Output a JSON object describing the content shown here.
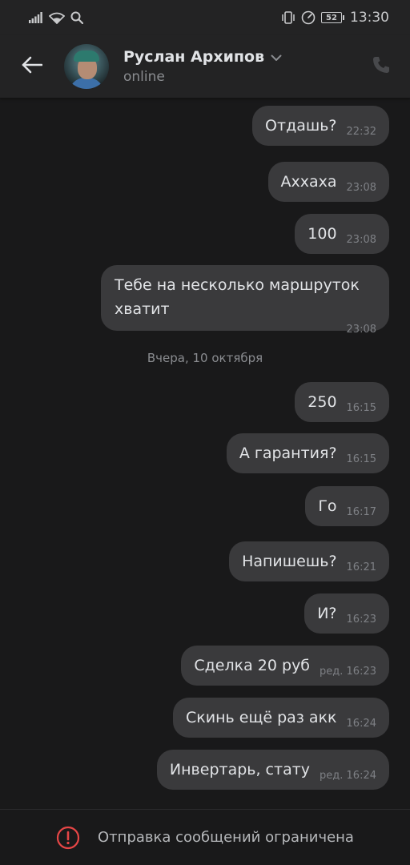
{
  "status_bar": {
    "time": "13:30",
    "battery": "52",
    "icons": [
      "signal-icon",
      "wifi-icon",
      "search-icon",
      "vibrate-icon",
      "speedometer-icon",
      "battery-icon"
    ]
  },
  "header": {
    "name": "Руслан Архипов",
    "status": "online",
    "icons": [
      "back-arrow-icon",
      "chevron-down-icon",
      "phone-icon"
    ]
  },
  "messages": [
    {
      "text": "Отдашь?",
      "time": "22:32"
    },
    {
      "text": "Аххаха",
      "time": "23:08"
    },
    {
      "text": "100",
      "time": "23:08"
    },
    {
      "text": "Тебе на несколько маршруток хватит",
      "time": "23:08"
    },
    {
      "text": "250",
      "time": "16:15"
    },
    {
      "text": "А гарантия?",
      "time": "16:15"
    },
    {
      "text": "Го",
      "time": "16:17"
    },
    {
      "text": "Напишешь?",
      "time": "16:21"
    },
    {
      "text": "И?",
      "time": "16:23"
    },
    {
      "text": "Сделка 20 руб",
      "time": "ред. 16:23"
    },
    {
      "text": "Скинь ещё раз акк",
      "time": "16:24"
    },
    {
      "text": "Инвертарь, стату",
      "time": "ред. 16:24"
    }
  ],
  "date_separator": "Вчера, 10 октября",
  "bottom": {
    "text": "Отправка сообщений ограничена",
    "icon": "alert-circle-icon",
    "accent": "#e64646"
  },
  "colors": {
    "background": "#19191a",
    "bubble": "#3a3a3c",
    "header": "#232324"
  }
}
